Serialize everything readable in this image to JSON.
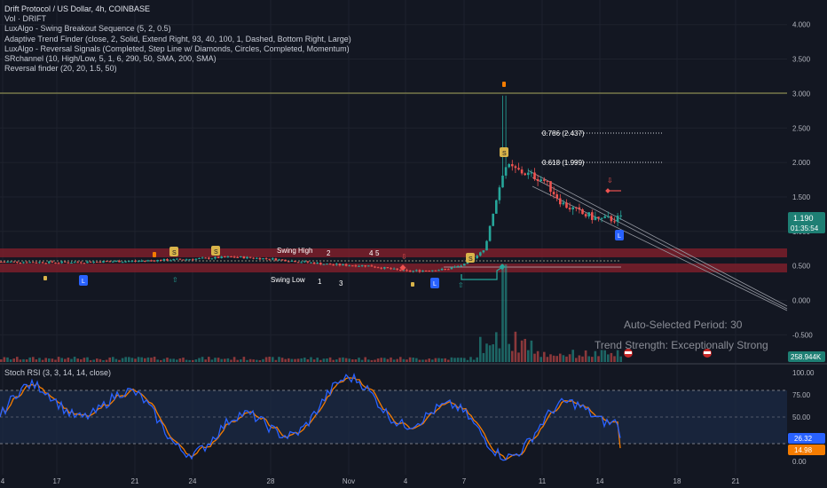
{
  "title": "Drift Protocol / US Dollar, 4h, COINBASE",
  "indicators": [
    "Vol · DRIFT",
    "LuxAlgo - Swing Breakout Sequence (5, 2, 0.5)",
    "Adaptive Trend Finder (close, 2, Solid, Extend Right, 93, 40, 100, 1, Dashed, Bottom Right, Large)",
    "LuxAlgo - Reversal Signals (Completed, Step Line w/ Diamonds, Circles, Completed, Momentum)",
    "SRchannel (10, High/Low, 5, 1, 6, 290, 50, SMA, 200, SMA)",
    "Reversal finder (20, 20, 1.5, 50)"
  ],
  "rsi_legend": "Stoch RSI (3, 3, 14, 14, close)",
  "colors": {
    "background": "#131722",
    "up": "#26a69a",
    "down": "#ef5350",
    "price_label": "#1e7f74",
    "sr_zone": "#7b1f2a",
    "label_yellow": "#d9b44a",
    "label_blue": "#2962ff",
    "rsi_blue": "#2962ff",
    "rsi_orange": "#f57c00",
    "fib_line": "#d1d4dc",
    "resistance_line": "#a5a55a"
  },
  "price_axis": [
    "4.000",
    "3.500",
    "3.000",
    "2.500",
    "2.000",
    "1.500",
    "1.000",
    "0.500",
    "0.000",
    "-0.500"
  ],
  "price_label": {
    "value": "1.190",
    "countdown": "01:35:54"
  },
  "volume_label": "258.944K",
  "rsi_axis": [
    "100.00",
    "75.00",
    "50.00",
    "25.00",
    "0.00"
  ],
  "rsi_labels": {
    "k": "26.32",
    "d": "14.98"
  },
  "time_axis": [
    "4",
    "17",
    "21",
    "24",
    "28",
    "Nov",
    "4",
    "7",
    "11",
    "14",
    "18",
    "21"
  ],
  "annotations": {
    "swing_high": "Swing High",
    "swing_low": "Swing Low",
    "fib_786": "0.786 (2.437)",
    "fib_618": "0.618 (1.999)",
    "auto_period": "Auto-Selected Period: 30",
    "trend_strength": "Trend Strength: Exceptionally Strong",
    "seq_numbers": [
      "1",
      "2",
      "3",
      "4",
      "5"
    ],
    "markers": {
      "s": "S",
      "l": "L"
    }
  },
  "chart_data": {
    "type": "candlestick",
    "title": "Drift Protocol / US Dollar, 4h, COINBASE",
    "y_range": [
      -0.55,
      4.15
    ],
    "resistance_level": 3.0,
    "sr_zones": [
      [
        0.64,
        0.76
      ],
      [
        0.41,
        0.53
      ]
    ],
    "fib_levels": [
      {
        "ratio": 0.786,
        "price": 2.437
      },
      {
        "ratio": 0.618,
        "price": 1.999
      }
    ],
    "last_price": 1.19,
    "price_anchors": [
      {
        "date": "Oct 13",
        "price": 0.56
      },
      {
        "date": "Oct 17",
        "price": 0.55
      },
      {
        "date": "Oct 21",
        "price": 0.57
      },
      {
        "date": "Oct 24",
        "price": 0.6
      },
      {
        "date": "Oct 26",
        "price": 0.63
      },
      {
        "date": "Oct 28",
        "price": 0.6
      },
      {
        "date": "Oct 31",
        "price": 0.52
      },
      {
        "date": "Nov 2",
        "price": 0.5
      },
      {
        "date": "Nov 4",
        "price": 0.42
      },
      {
        "date": "Nov 6",
        "price": 0.45
      },
      {
        "date": "Nov 7",
        "price": 0.52
      },
      {
        "date": "Nov 8",
        "price": 0.75
      },
      {
        "date": "Nov 9",
        "price": 1.95
      },
      {
        "date": "Nov 10",
        "price": 1.85
      },
      {
        "date": "Nov 11",
        "price": 1.75
      },
      {
        "date": "Nov 12",
        "price": 1.4
      },
      {
        "date": "Nov 13",
        "price": 1.25
      },
      {
        "date": "Nov 14",
        "price": 1.17
      },
      {
        "date": "Nov 15",
        "price": 1.19
      }
    ],
    "spike_high": 2.97,
    "rsi_range": [
      0,
      100
    ],
    "rsi_levels": [
      80,
      50,
      20
    ],
    "stoch_rsi_last": {
      "k": 26.32,
      "d": 14.98
    }
  }
}
